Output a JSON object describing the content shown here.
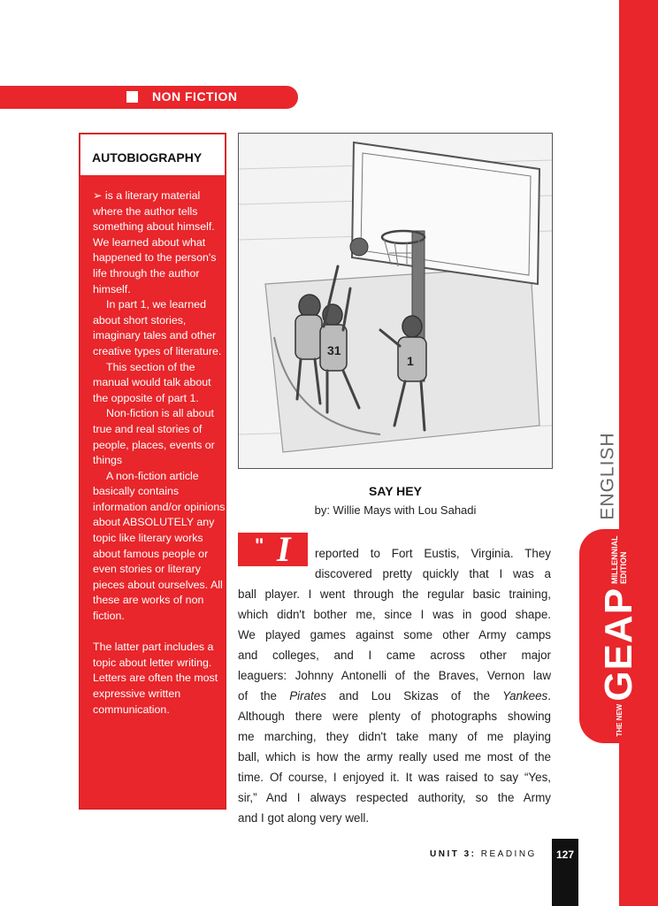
{
  "section": {
    "label": "NON FICTION"
  },
  "sidebar": {
    "title": "AUTOBIOGRAPHY",
    "paragraphs": [
      "➢ is a literary material where the author tells something about himself. We learned about what happened to the person's life through the author himself.",
      "In part 1, we learned about short stories, imaginary tales and other creative types of literature.",
      "This section of the manual would talk about the opposite of part 1.",
      "Non-fiction is all about true and real stories of people, places, events or things",
      "A non-fiction article basically contains information and/or opinions about ABSOLUTELY any topic like literary works about famous people or even stories or literary pieces about ourselves. All these are works of non fiction.",
      "The latter part includes a topic about letter writing. Letters are often the most expressive written communication."
    ]
  },
  "illustration": {
    "description_icon": "basketball-sketch"
  },
  "story": {
    "title": "SAY HEY",
    "byline": "by: Willie Mays with Lou Sahadi",
    "dropcap_quote": "\"",
    "dropcap_letter": "I",
    "lines": [
      "reported to Fort Eustis, Virginia. They",
      "discovered pretty quickly that I was a",
      "ball player. I went through the regular basic training,",
      "which didn't bother me, since I was in good shape.",
      "We played games against some other Army camps",
      "and colleges, and I came across other major",
      "leaguers: Johnny Antonelli of the Braves, Vernon law",
      "of the Pirates and Lou Skizas of the Yankees.",
      "Although there were plenty of photographs showing",
      "me marching, they didn't take many of me playing",
      "ball, which is how the army really used me most of the",
      "time. Of course, I enjoyed it. It was raised to say “Yes,",
      "sir,” And I always respected authority, so the Army",
      "and I got along very well."
    ]
  },
  "side_tab": {
    "subject": "ENGLISH",
    "the_new": "THE NEW",
    "brand": "GEAP",
    "edition_line1": "MILLENNIAL",
    "edition_line2": "EDITION"
  },
  "footer": {
    "unit_bold": "UNIT 3:",
    "unit_rest": " READING",
    "page_number": "127"
  },
  "colors": {
    "accent": "#e8262b",
    "text": "#222222",
    "page_box": "#111111"
  }
}
